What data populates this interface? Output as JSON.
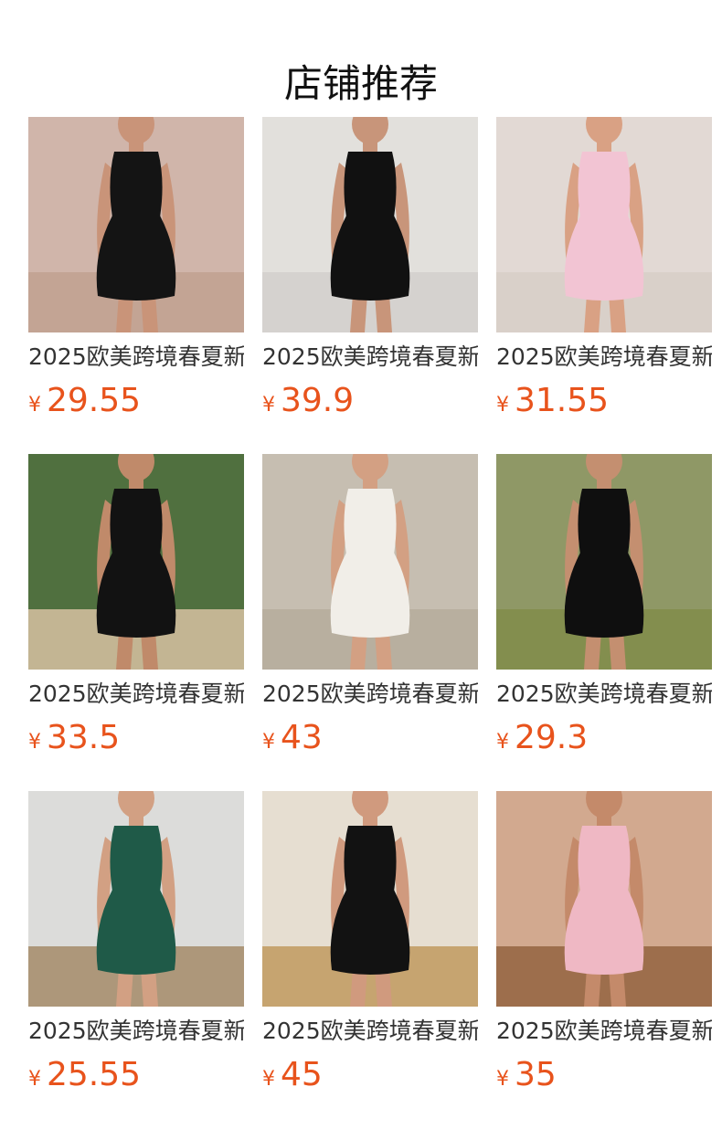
{
  "page": {
    "title": "店铺推荐"
  },
  "currency_symbol": "¥",
  "colors": {
    "price": "#e8531c",
    "title": "#111111",
    "text": "#333333"
  },
  "products": [
    {
      "name": "2025欧美跨境春夏新",
      "price": "29.55",
      "image": "black-sleeveless-mini-dress-photo",
      "palette": {
        "bg": "#d8cbbd",
        "floor": "#c9b8a4",
        "dress": "#141414",
        "skin": "#c99479",
        "accent": "#9b1b20"
      }
    },
    {
      "name": "2025欧美跨境春夏新",
      "price": "39.9",
      "image": "black-off-shoulder-dress-photo",
      "palette": {
        "bg": "#e8e6e2",
        "floor": "#d9d7d3",
        "dress": "#111111",
        "skin": "#c8957a",
        "accent": "#bcb9b4"
      }
    },
    {
      "name": "2025欧美跨境春夏新",
      "price": "31.55",
      "image": "pink-maxi-slit-dress-photo",
      "palette": {
        "bg": "#ece8e4",
        "floor": "#e2ddd8",
        "dress": "#f2c4d3",
        "skin": "#d9a184",
        "accent": "#a07060"
      }
    },
    {
      "name": "2025欧美跨境春夏新",
      "price": "33.5",
      "image": "black-square-neck-mini-dress-photo",
      "palette": {
        "bg": "#4b6a3c",
        "floor": "#cdb99b",
        "dress": "#121212",
        "skin": "#c08a6a",
        "accent": "#7e9b5a"
      }
    },
    {
      "name": "2025欧美跨境春夏新",
      "price": "43",
      "image": "white-corset-slit-dress-photo",
      "palette": {
        "bg": "#cfc7ba",
        "floor": "#bfb5a6",
        "dress": "#f1eee8",
        "skin": "#d3a083",
        "accent": "#8f8577"
      }
    },
    {
      "name": "2025欧美跨境春夏新",
      "price": "29.3",
      "image": "black-one-shoulder-maxi-dress-photo",
      "palette": {
        "bg": "#8a9a6a",
        "floor": "#7d8f4f",
        "dress": "#0f0f0f",
        "skin": "#c48f70",
        "accent": "#b58a4c"
      }
    },
    {
      "name": "2025欧美跨境春夏新",
      "price": "25.55",
      "image": "green-strapless-slit-gown-photo",
      "palette": {
        "bg": "#eeeeec",
        "floor": "#b9a07f",
        "dress": "#1f5a48",
        "skin": "#d2a083",
        "accent": "#5a5a58"
      }
    },
    {
      "name": "2025欧美跨境春夏新",
      "price": "45",
      "image": "black-ruffle-slit-dress-photo",
      "palette": {
        "bg": "#ede9e2",
        "floor": "#c9a773",
        "dress": "#121212",
        "skin": "#d09a7e",
        "accent": "#b8935a"
      }
    },
    {
      "name": "2025欧美跨境春夏新",
      "price": "35",
      "image": "pink-long-sleeve-mini-dress-photo",
      "palette": {
        "bg": "#dcb39a",
        "floor": "#a0704e",
        "dress": "#efb8c4",
        "skin": "#c48a6a",
        "accent": "#8e5f42"
      }
    }
  ]
}
